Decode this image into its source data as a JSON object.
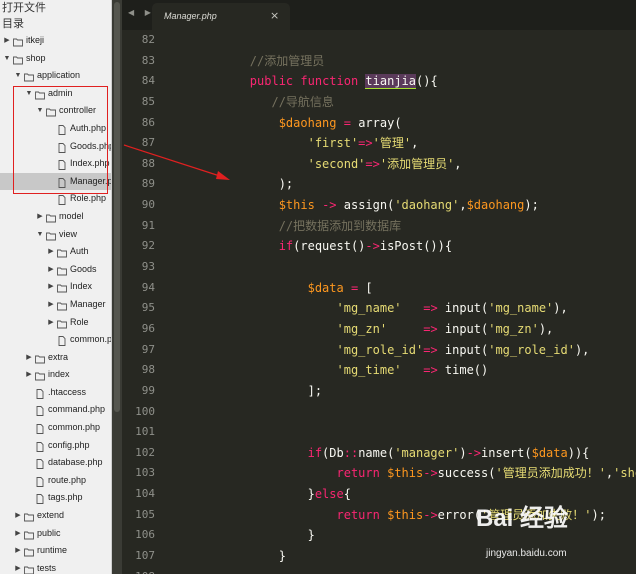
{
  "sidebar": {
    "open_files_label": "打开文件",
    "folders_label": "目录",
    "items": [
      {
        "label": "itkeji",
        "type": "folder",
        "open": false,
        "depth": 0
      },
      {
        "label": "shop",
        "type": "folder",
        "open": true,
        "depth": 0
      },
      {
        "label": "application",
        "type": "folder",
        "open": true,
        "depth": 1
      },
      {
        "label": "admin",
        "type": "folder",
        "open": true,
        "depth": 2
      },
      {
        "label": "controller",
        "type": "folder",
        "open": true,
        "depth": 3
      },
      {
        "label": "Auth.php",
        "type": "file",
        "depth": 4
      },
      {
        "label": "Goods.php",
        "type": "file",
        "depth": 4
      },
      {
        "label": "Index.php",
        "type": "file",
        "depth": 4
      },
      {
        "label": "Manager.php",
        "type": "file",
        "depth": 4,
        "selected": true
      },
      {
        "label": "Role.php",
        "type": "file",
        "depth": 4
      },
      {
        "label": "model",
        "type": "folder",
        "open": false,
        "depth": 3
      },
      {
        "label": "view",
        "type": "folder",
        "open": true,
        "depth": 3
      },
      {
        "label": "Auth",
        "type": "folder",
        "open": false,
        "depth": 4
      },
      {
        "label": "Goods",
        "type": "folder",
        "open": false,
        "depth": 4
      },
      {
        "label": "Index",
        "type": "folder",
        "open": false,
        "depth": 4
      },
      {
        "label": "Manager",
        "type": "folder",
        "open": false,
        "depth": 4
      },
      {
        "label": "Role",
        "type": "folder",
        "open": false,
        "depth": 4
      },
      {
        "label": "common.php",
        "type": "file",
        "depth": 4
      },
      {
        "label": "extra",
        "type": "folder",
        "open": false,
        "depth": 2
      },
      {
        "label": "index",
        "type": "folder",
        "open": false,
        "depth": 2
      },
      {
        "label": ".htaccess",
        "type": "file",
        "depth": 2
      },
      {
        "label": "command.php",
        "type": "file",
        "depth": 2
      },
      {
        "label": "common.php",
        "type": "file",
        "depth": 2
      },
      {
        "label": "config.php",
        "type": "file",
        "depth": 2
      },
      {
        "label": "database.php",
        "type": "file",
        "depth": 2
      },
      {
        "label": "route.php",
        "type": "file",
        "depth": 2
      },
      {
        "label": "tags.php",
        "type": "file",
        "depth": 2
      },
      {
        "label": "extend",
        "type": "folder",
        "open": false,
        "depth": 1
      },
      {
        "label": "public",
        "type": "folder",
        "open": false,
        "depth": 1
      },
      {
        "label": "runtime",
        "type": "folder",
        "open": false,
        "depth": 1
      },
      {
        "label": "tests",
        "type": "folder",
        "open": false,
        "depth": 1
      }
    ]
  },
  "tab": {
    "name": "Manager.php",
    "close": "×",
    "nav_arrows": "◀ ▶"
  },
  "editor": {
    "line_numbers": [
      "82",
      "83",
      "84",
      "85",
      "86",
      "87",
      "88",
      "89",
      "90",
      "91",
      "92",
      "93",
      "94",
      "95",
      "96",
      "97",
      "98",
      "99",
      "100",
      "101",
      "102",
      "103",
      "104",
      "105",
      "106",
      "107",
      "108"
    ],
    "lines": [
      [],
      [
        {
          "t": "        "
        },
        {
          "t": "//添加管理员",
          "c": "c"
        }
      ],
      [
        {
          "t": "        "
        },
        {
          "t": "public",
          "c": "k"
        },
        {
          "t": " "
        },
        {
          "t": "function",
          "c": "k"
        },
        {
          "t": " "
        },
        {
          "t": "tianjia",
          "c": "hl"
        },
        {
          "t": "(){"
        }
      ],
      [
        {
          "t": "           "
        },
        {
          "t": "//导航信息",
          "c": "c"
        }
      ],
      [
        {
          "t": "            "
        },
        {
          "t": "$daohang",
          "c": "v"
        },
        {
          "t": " "
        },
        {
          "t": "=",
          "c": "k"
        },
        {
          "t": " array("
        }
      ],
      [
        {
          "t": "                "
        },
        {
          "t": "'first'",
          "c": "s"
        },
        {
          "t": "=>",
          "c": "k"
        },
        {
          "t": "'管理'",
          "c": "s"
        },
        {
          "t": ","
        }
      ],
      [
        {
          "t": "                "
        },
        {
          "t": "'second'",
          "c": "s"
        },
        {
          "t": "=>",
          "c": "k"
        },
        {
          "t": "'添加管理员'",
          "c": "s"
        },
        {
          "t": ","
        }
      ],
      [
        {
          "t": "            );"
        }
      ],
      [
        {
          "t": "            "
        },
        {
          "t": "$this",
          "c": "v"
        },
        {
          "t": " "
        },
        {
          "t": "->",
          "c": "k"
        },
        {
          "t": " assign("
        },
        {
          "t": "'daohang'",
          "c": "s"
        },
        {
          "t": ","
        },
        {
          "t": "$daohang",
          "c": "v"
        },
        {
          "t": ");"
        }
      ],
      [
        {
          "t": "            "
        },
        {
          "t": "//把数据添加到数据库",
          "c": "c"
        }
      ],
      [
        {
          "t": "            "
        },
        {
          "t": "if",
          "c": "k"
        },
        {
          "t": "(request()"
        },
        {
          "t": "->",
          "c": "k"
        },
        {
          "t": "isPost()){"
        }
      ],
      [],
      [
        {
          "t": "                "
        },
        {
          "t": "$data",
          "c": "v"
        },
        {
          "t": " "
        },
        {
          "t": "=",
          "c": "k"
        },
        {
          "t": " ["
        }
      ],
      [
        {
          "t": "                    "
        },
        {
          "t": "'mg_name'",
          "c": "s"
        },
        {
          "t": "   "
        },
        {
          "t": "=>",
          "c": "k"
        },
        {
          "t": " input("
        },
        {
          "t": "'mg_name'",
          "c": "s"
        },
        {
          "t": "),"
        }
      ],
      [
        {
          "t": "                    "
        },
        {
          "t": "'mg_zn'",
          "c": "s"
        },
        {
          "t": "     "
        },
        {
          "t": "=>",
          "c": "k"
        },
        {
          "t": " input("
        },
        {
          "t": "'mg_zn'",
          "c": "s"
        },
        {
          "t": "),"
        }
      ],
      [
        {
          "t": "                    "
        },
        {
          "t": "'mg_role_id'",
          "c": "s"
        },
        {
          "t": "=>",
          "c": "k"
        },
        {
          "t": " input("
        },
        {
          "t": "'mg_role_id'",
          "c": "s"
        },
        {
          "t": "),"
        }
      ],
      [
        {
          "t": "                    "
        },
        {
          "t": "'mg_time'",
          "c": "s"
        },
        {
          "t": "   "
        },
        {
          "t": "=>",
          "c": "k"
        },
        {
          "t": " time()"
        }
      ],
      [
        {
          "t": "                ];"
        }
      ],
      [],
      [],
      [
        {
          "t": "                "
        },
        {
          "t": "if",
          "c": "k"
        },
        {
          "t": "(Db"
        },
        {
          "t": "::",
          "c": "k"
        },
        {
          "t": "name("
        },
        {
          "t": "'manager'",
          "c": "s"
        },
        {
          "t": ")"
        },
        {
          "t": "->",
          "c": "k"
        },
        {
          "t": "insert("
        },
        {
          "t": "$data",
          "c": "v"
        },
        {
          "t": ")){"
        }
      ],
      [
        {
          "t": "                    "
        },
        {
          "t": "return",
          "c": "k"
        },
        {
          "t": " "
        },
        {
          "t": "$this",
          "c": "v"
        },
        {
          "t": "->",
          "c": "k"
        },
        {
          "t": "success("
        },
        {
          "t": "'管理员添加成功！'",
          "c": "s"
        },
        {
          "t": ","
        },
        {
          "t": "'showlist'",
          "c": "s"
        },
        {
          "t": ");"
        }
      ],
      [
        {
          "t": "                }"
        },
        {
          "t": "else",
          "c": "k"
        },
        {
          "t": "{"
        }
      ],
      [
        {
          "t": "                    "
        },
        {
          "t": "return",
          "c": "k"
        },
        {
          "t": " "
        },
        {
          "t": "$this",
          "c": "v"
        },
        {
          "t": "->",
          "c": "k"
        },
        {
          "t": "error("
        },
        {
          "t": "'管理员添加失败！'",
          "c": "s"
        },
        {
          "t": ");"
        }
      ],
      [
        {
          "t": "                }"
        }
      ],
      [
        {
          "t": "            }"
        }
      ],
      []
    ]
  },
  "watermark": {
    "logo": "Bai 经验",
    "url": "jingyan.baidu.com"
  },
  "colors": {
    "keyword": "#f92672",
    "string": "#e6db74",
    "variable": "#fd971f",
    "comment": "#75715e",
    "background": "#272822",
    "annotation": "#e02020"
  }
}
